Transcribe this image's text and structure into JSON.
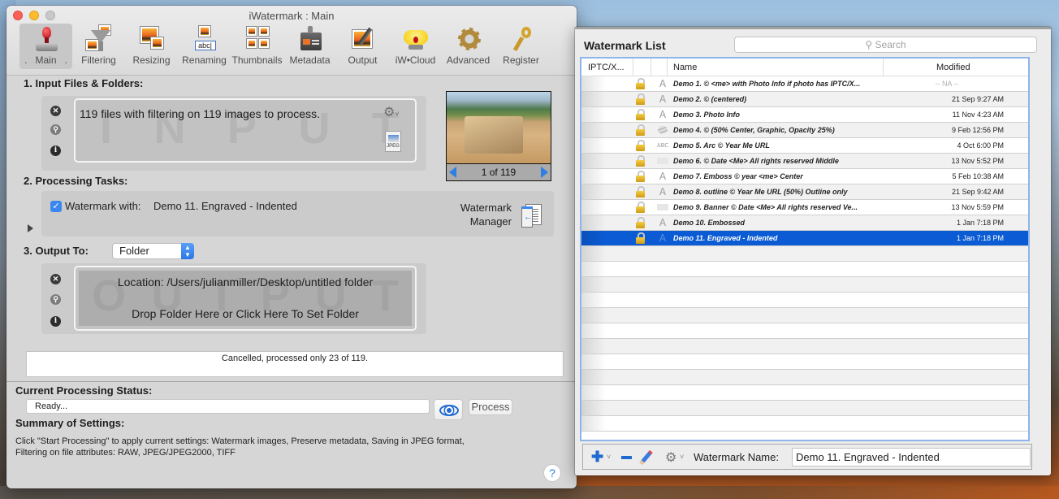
{
  "main_window": {
    "title": "iWatermark : Main",
    "toolbar": [
      {
        "id": "main",
        "label": ".   Main   .",
        "icon": "stamp-icon",
        "active": true
      },
      {
        "id": "filtering",
        "label": "Filtering",
        "icon": "funnel-icon"
      },
      {
        "id": "resizing",
        "label": "Resizing",
        "icon": "resize-icon"
      },
      {
        "id": "renaming",
        "label": "Renaming",
        "icon": "rename-icon",
        "icon_text": "abc|"
      },
      {
        "id": "thumbnails",
        "label": "Thumbnails",
        "icon": "thumbnails-icon"
      },
      {
        "id": "metadata",
        "label": "Metadata",
        "icon": "badge-icon"
      },
      {
        "id": "output",
        "label": "Output",
        "icon": "output-icon"
      },
      {
        "id": "iwcloud",
        "label": "iW•Cloud",
        "icon": "cloud-icon"
      },
      {
        "id": "advanced",
        "label": "Advanced",
        "icon": "gear-icon"
      },
      {
        "id": "register",
        "label": "Register",
        "icon": "key-icon"
      }
    ],
    "input": {
      "heading": "1. Input Files & Folders:",
      "summary": "119 files with filtering on 119 images to process.",
      "ghost_text": [
        "I",
        "N",
        "P",
        "U",
        "T"
      ],
      "file_type": "JPEG",
      "preview_counter": "1 of 119"
    },
    "tasks": {
      "heading": "2. Processing Tasks:",
      "watermark_checked": true,
      "watermark_with_label": "Watermark with:",
      "watermark_name": "Demo 11. Engraved - Indented",
      "manager_label_1": "Watermark",
      "manager_label_2": "Manager"
    },
    "output": {
      "heading": "3. Output To:",
      "destination": "Folder",
      "location": "Location: /Users/julianmiller/Desktop/untitled folder",
      "drop_hint": "Drop Folder Here or Click Here To Set Folder",
      "ghost_text": [
        "O",
        "U",
        "T",
        "P",
        "U",
        "T"
      ]
    },
    "status_message": "Cancelled, processed only 23 of 119.",
    "processing": {
      "heading": "Current Processing Status:",
      "status": "Ready...",
      "process_label": "Process"
    },
    "summary": {
      "heading": "Summary of Settings:",
      "line1": "Click \"Start Processing\" to apply current settings: Watermark images, Preserve metadata, Saving in JPEG format,",
      "line2": "Filtering on file attributes: RAW, JPEG/JPEG2000, TIFF"
    },
    "help_label": "?"
  },
  "watermark_list": {
    "title": "Watermark List",
    "search_placeholder": "Search",
    "columns": {
      "iptc": "IPTC/X...",
      "name": "Name",
      "modified": "Modified"
    },
    "rows": [
      {
        "name": "Demo  1. © <me> with Photo Info if photo has IPTC/X...",
        "modified": "-- NA --",
        "type": "text",
        "locked": true,
        "na": true
      },
      {
        "name": "Demo  2. © (centered)",
        "modified": "21 Sep  9:27 AM",
        "type": "text",
        "locked": true
      },
      {
        "name": "Demo  3. Photo Info",
        "modified": "11 Nov  4:23 AM",
        "type": "text",
        "locked": true
      },
      {
        "name": "Demo  4. © (50% Center, Graphic, Opacity 25%)",
        "modified": "9 Feb 12:56 PM",
        "type": "graphic",
        "locked": true
      },
      {
        "name": "Demo  5. Arc © Year Me URL",
        "modified": "4 Oct  6:00 PM",
        "type": "arc",
        "locked": true
      },
      {
        "name": "Demo  6. © Date <Me> All rights reserved Middle",
        "modified": "13 Nov  5:52 PM",
        "type": "banner",
        "locked": true
      },
      {
        "name": "Demo  7. Emboss © year <me> Center",
        "modified": "5 Feb 10:38 AM",
        "type": "text",
        "locked": true
      },
      {
        "name": "Demo  8. outline © Year Me URL (50%) Outline only",
        "modified": "21 Sep  9:42 AM",
        "type": "text",
        "locked": true
      },
      {
        "name": "Demo  9. Banner © Date <Me> All rights reserved Ve...",
        "modified": "13 Nov  5:59 PM",
        "type": "banner",
        "locked": true
      },
      {
        "name": "Demo 10. Embossed",
        "modified": "1 Jan  7:18 PM",
        "type": "text",
        "locked": true
      },
      {
        "name": "Demo 11. Engraved - Indented",
        "modified": "1 Jan  7:18 PM",
        "type": "text",
        "locked": true,
        "selected": true
      }
    ],
    "empty_rows": 12,
    "footer": {
      "name_label": "Watermark Name:",
      "name_value": "Demo 11. Engraved - Indented"
    },
    "selection_color": "#0a5bd4"
  }
}
